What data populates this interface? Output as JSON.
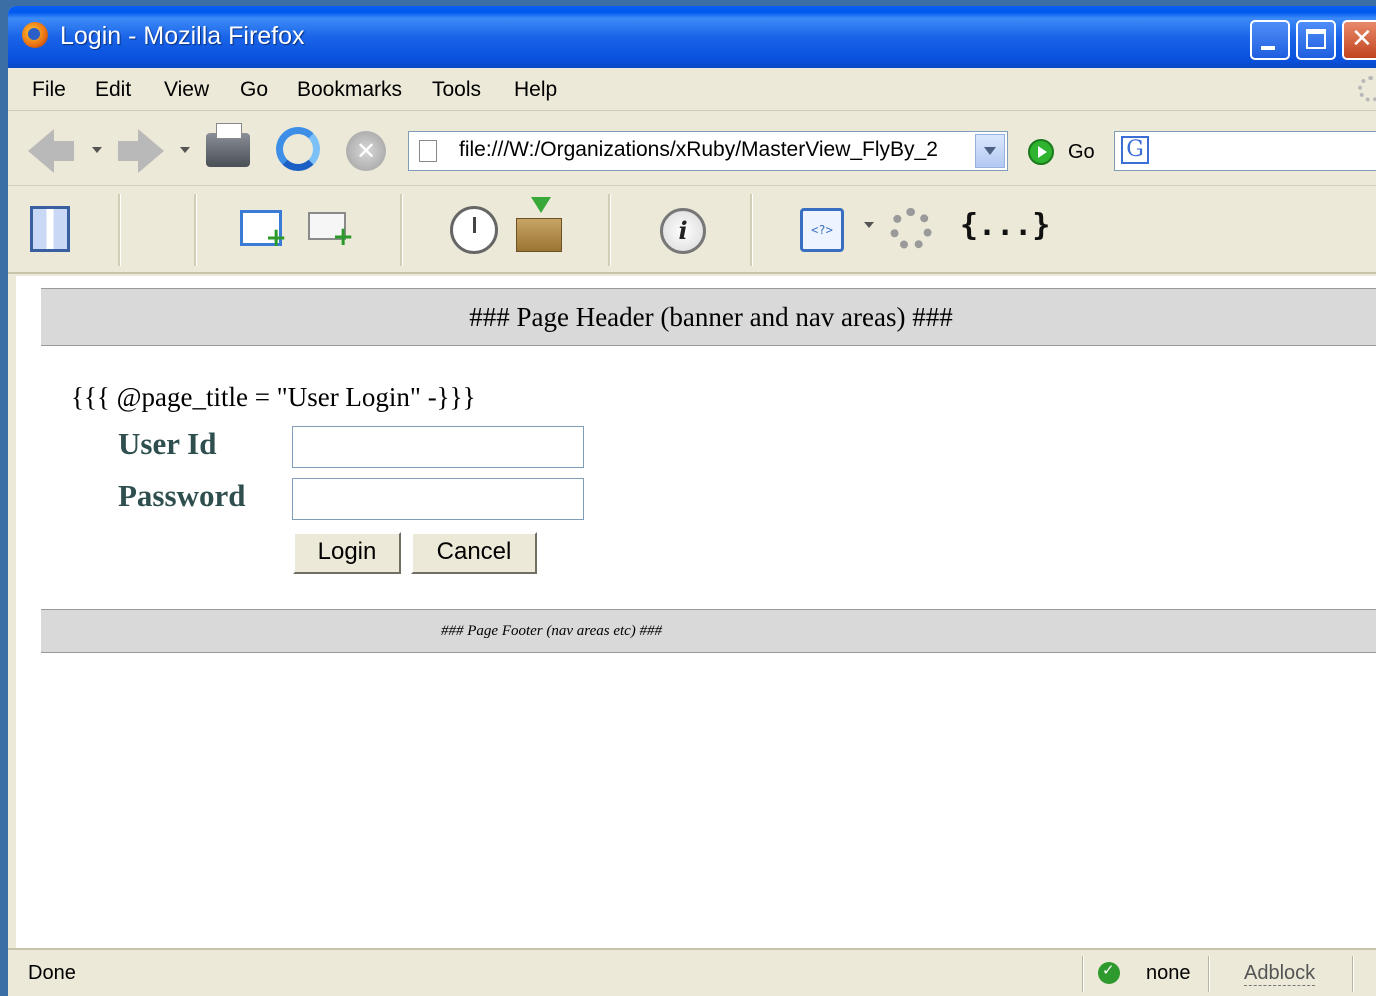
{
  "window": {
    "title": "Login - Mozilla Firefox"
  },
  "menubar": {
    "items": [
      "File",
      "Edit",
      "View",
      "Go",
      "Bookmarks",
      "Tools",
      "Help"
    ]
  },
  "navbar": {
    "url": "file:///W:/Organizations/xRuby/MasterView_FlyBy_2",
    "go_label": "Go"
  },
  "toolbar2": {
    "source_icon_text": "<?>",
    "info_icon_text": "i",
    "brace_icon_text": "{...}"
  },
  "page": {
    "header_text": "### Page Header (banner and nav areas) ###",
    "title_template": "{{{ @page_title = \"User Login\" -}}}",
    "form": {
      "user_id_label": "User Id",
      "password_label": "Password",
      "user_id_value": "",
      "password_value": "",
      "login_button": "Login",
      "cancel_button": "Cancel"
    },
    "footer_text": "### Page Footer (nav areas etc) ###"
  },
  "statusbar": {
    "status": "Done",
    "proxy": "none",
    "adblock": "Adblock"
  },
  "colors": {
    "titlebar": "#0058ee",
    "chrome": "#ece9d8",
    "label": "#2f4f4f",
    "band": "#d9d9d9"
  }
}
